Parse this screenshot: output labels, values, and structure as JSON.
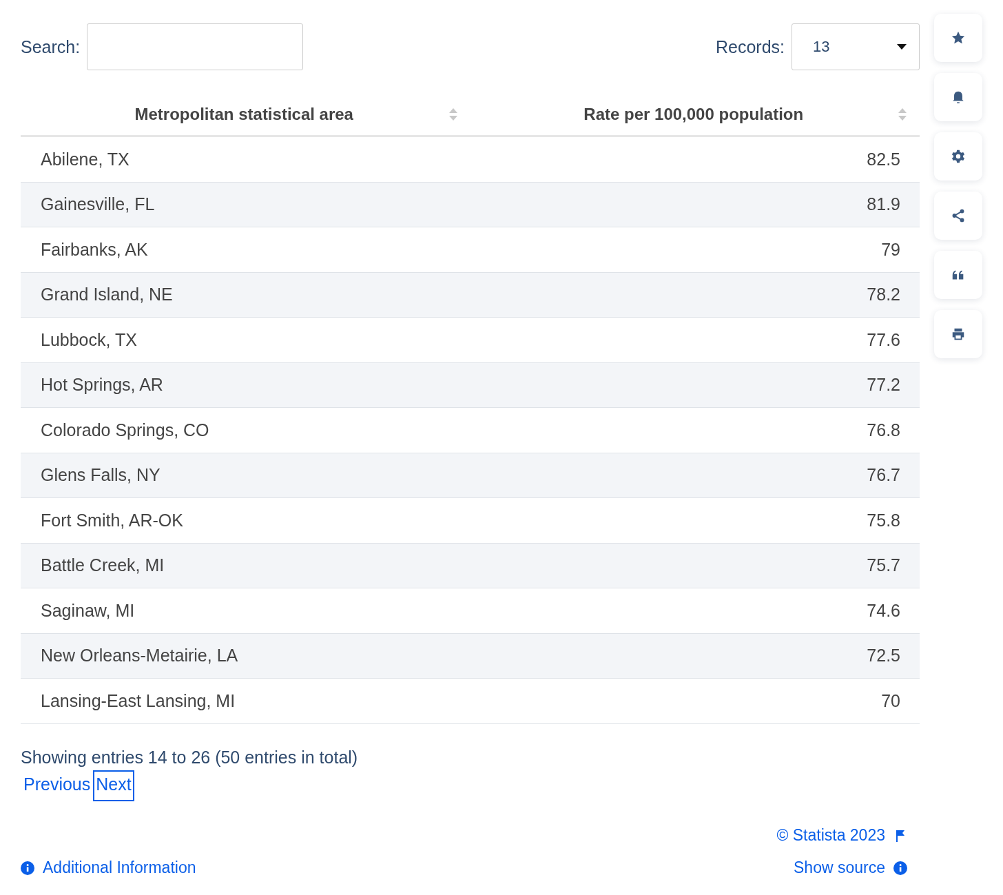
{
  "search": {
    "label": "Search:"
  },
  "records": {
    "label": "Records:",
    "value": "13"
  },
  "table": {
    "columns": [
      {
        "label": "Metropolitan statistical area"
      },
      {
        "label": "Rate per 100,000 population"
      }
    ],
    "rows": [
      {
        "area": "Abilene, TX",
        "rate": "82.5"
      },
      {
        "area": "Gainesville, FL",
        "rate": "81.9"
      },
      {
        "area": "Fairbanks, AK",
        "rate": "79"
      },
      {
        "area": "Grand Island, NE",
        "rate": "78.2"
      },
      {
        "area": "Lubbock, TX",
        "rate": "77.6"
      },
      {
        "area": "Hot Springs, AR",
        "rate": "77.2"
      },
      {
        "area": "Colorado Springs, CO",
        "rate": "76.8"
      },
      {
        "area": "Glens Falls, NY",
        "rate": "76.7"
      },
      {
        "area": "Fort Smith, AR-OK",
        "rate": "75.8"
      },
      {
        "area": "Battle Creek, MI",
        "rate": "75.7"
      },
      {
        "area": "Saginaw, MI",
        "rate": "74.6"
      },
      {
        "area": "New Orleans-Metairie, LA",
        "rate": "72.5"
      },
      {
        "area": "Lansing-East Lansing, MI",
        "rate": "70"
      }
    ]
  },
  "entries_info": "Showing entries 14 to 26 (50 entries in total)",
  "pagination": [
    {
      "label": "Previous",
      "focused": false
    },
    {
      "label": "Next",
      "focused": true
    }
  ],
  "toolbar": [
    {
      "kind": "star"
    },
    {
      "kind": "bell"
    },
    {
      "kind": "gear"
    },
    {
      "kind": "share"
    },
    {
      "kind": "quote"
    },
    {
      "kind": "print"
    }
  ],
  "footer": {
    "copyright": "© Statista 2023",
    "show_source": "Show source",
    "additional_info": "Additional Information"
  }
}
